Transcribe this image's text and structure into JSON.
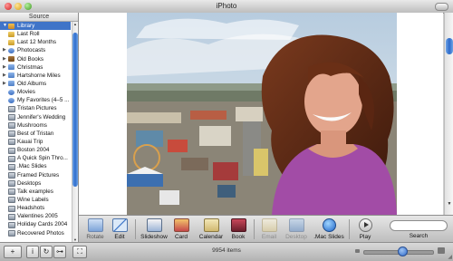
{
  "window": {
    "title": "iPhoto"
  },
  "sidebar": {
    "header": "Source",
    "items": [
      {
        "label": "Library",
        "icon": "library-icon",
        "cls": "ic-lib",
        "disclosure": "▼",
        "selected": true
      },
      {
        "label": "Last Roll",
        "icon": "film-roll-icon",
        "cls": "ic-roll",
        "disclosure": ""
      },
      {
        "label": "Last 12 Months",
        "icon": "calendar-roll-icon",
        "cls": "ic-roll",
        "disclosure": ""
      },
      {
        "label": "Photocasts",
        "icon": "photocast-icon",
        "cls": "ic-smart",
        "disclosure": "▶"
      },
      {
        "label": "Old Books",
        "icon": "book-icon",
        "cls": "ic-book",
        "disclosure": "▶"
      },
      {
        "label": "Christmas",
        "icon": "folder-icon",
        "cls": "ic-folder",
        "disclosure": "▶"
      },
      {
        "label": "Hartshorne Miles",
        "icon": "folder-icon",
        "cls": "ic-folder",
        "disclosure": "▶"
      },
      {
        "label": "Old Albums",
        "icon": "folder-icon",
        "cls": "ic-folder",
        "disclosure": "▶"
      },
      {
        "label": "Movies",
        "icon": "smart-album-icon",
        "cls": "ic-smart",
        "disclosure": ""
      },
      {
        "label": "My Favorites (4–5 ...",
        "icon": "smart-album-icon",
        "cls": "ic-smart",
        "disclosure": ""
      },
      {
        "label": "Tristan Pictures",
        "icon": "album-icon",
        "cls": "ic-album",
        "disclosure": ""
      },
      {
        "label": "Jennifer's Wedding",
        "icon": "album-icon",
        "cls": "ic-album",
        "disclosure": ""
      },
      {
        "label": "Mushrooms",
        "icon": "album-icon",
        "cls": "ic-album",
        "disclosure": ""
      },
      {
        "label": "Best of Tristan",
        "icon": "album-icon",
        "cls": "ic-album",
        "disclosure": ""
      },
      {
        "label": "Kauai Trip",
        "icon": "album-icon",
        "cls": "ic-album",
        "disclosure": ""
      },
      {
        "label": "Boston 2004",
        "icon": "album-icon",
        "cls": "ic-album",
        "disclosure": ""
      },
      {
        "label": "A Quick Spin Thro...",
        "icon": "album-icon",
        "cls": "ic-album",
        "disclosure": ""
      },
      {
        "label": ".Mac Slides",
        "icon": "album-icon",
        "cls": "ic-album",
        "disclosure": ""
      },
      {
        "label": "Framed Pictures",
        "icon": "album-icon",
        "cls": "ic-album",
        "disclosure": ""
      },
      {
        "label": "Desktops",
        "icon": "album-icon",
        "cls": "ic-album",
        "disclosure": ""
      },
      {
        "label": "Talk examples",
        "icon": "album-icon",
        "cls": "ic-album",
        "disclosure": ""
      },
      {
        "label": "Wine Labels",
        "icon": "album-icon",
        "cls": "ic-album",
        "disclosure": ""
      },
      {
        "label": "Headshots",
        "icon": "album-icon",
        "cls": "ic-album",
        "disclosure": ""
      },
      {
        "label": "Valentines 2005",
        "icon": "album-icon",
        "cls": "ic-album",
        "disclosure": ""
      },
      {
        "label": "Holiday Cards 2004",
        "icon": "album-icon",
        "cls": "ic-album",
        "disclosure": ""
      },
      {
        "label": "Recovered Photos",
        "icon": "album-icon",
        "cls": "ic-album",
        "disclosure": ""
      }
    ]
  },
  "toolbar": {
    "rotate": "Rotate",
    "edit": "Edit",
    "slideshow": "Slideshow",
    "card": "Card",
    "calendar": "Calendar",
    "book": "Book",
    "email": "Email",
    "desktop": "Desktop",
    "mac_slides": ".Mac Slides",
    "play": "Play",
    "search": "Search"
  },
  "status": {
    "item_count": "9954 items"
  },
  "bottom_buttons": {
    "add": "+",
    "info": "i",
    "rotate_view": "↻",
    "keyword": "⊶",
    "fullscreen": "⛶"
  },
  "zoom": {
    "level_fraction": 0.55
  },
  "colors": {
    "selection": "#3f74c8",
    "scroll_thumb": "#2f6dcd"
  }
}
